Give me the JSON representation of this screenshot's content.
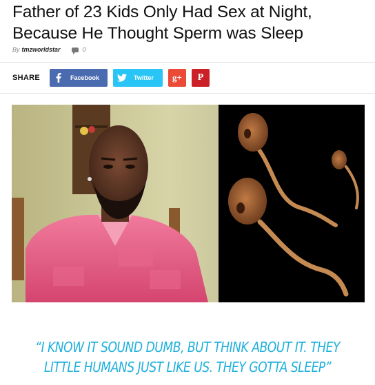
{
  "article": {
    "title_line1": "Father of 23 Kids Only Had Sex at Night,",
    "title_line2": "Because He Thought Sperm was Sleep",
    "by_prefix": "By",
    "author": "tmzworldstar",
    "comment_count": "0"
  },
  "share": {
    "label": "SHARE",
    "facebook_label": "Facebook",
    "twitter_label": "Twitter",
    "googleplus_label": "g+",
    "pinterest_label": "P"
  },
  "quote": {
    "line1": "“I KNOW IT SOUND DUMB, BUT THINK ABOUT IT. THEY",
    "line2": "LITTLE HUMANS JUST LIKE US. THEY GOTTA SLEEP”"
  },
  "colors": {
    "facebook": "#4b6bb0",
    "twitter": "#29c5f6",
    "googleplus": "#eb4a36",
    "pinterest": "#cb2027",
    "quote": "#1fb0dc",
    "shirt": "#e85d86"
  },
  "icons": {
    "facebook": "facebook-icon",
    "twitter": "twitter-icon",
    "comment": "comment-icon"
  }
}
